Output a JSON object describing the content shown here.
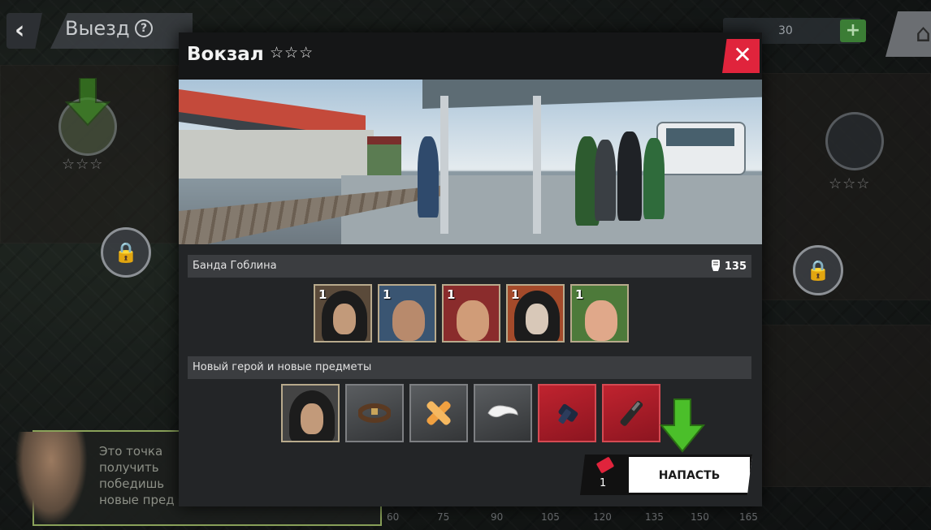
{
  "topbar": {
    "back_icon": "back-arrow-icon",
    "title": "Выезд",
    "help_icon": "help-icon",
    "resource_count": "30",
    "add_icon": "plus-icon",
    "home_icon": "home-icon"
  },
  "map": {
    "tutorial_text": "Это точка\nполучить\nпобедишь\nновые пред",
    "scale_values": [
      "60",
      "75",
      "90",
      "105",
      "120",
      "135",
      "150",
      "165"
    ],
    "node_stars": "☆☆☆"
  },
  "modal": {
    "title": "Вокзал",
    "stars": "☆☆☆",
    "close_icon": "close-icon",
    "scene": "railway-station-scene",
    "gang": {
      "label": "Банда Гоблина",
      "power": "135",
      "power_icon": "fist-icon",
      "members": [
        {
          "level": "1",
          "portrait": "hooded-thug-portrait"
        },
        {
          "level": "1",
          "portrait": "bearded-man-portrait"
        },
        {
          "level": "1",
          "portrait": "cap-man-portrait"
        },
        {
          "level": "1",
          "portrait": "hooded-pale-portrait"
        },
        {
          "level": "1",
          "portrait": "shouting-man-portrait"
        }
      ]
    },
    "rewards": {
      "label": "Новый герой и новые предметы",
      "items": [
        {
          "type": "hero",
          "icon": "hooded-hero-portrait"
        },
        {
          "type": "item",
          "icon": "belt-icon"
        },
        {
          "type": "item",
          "icon": "bandage-icon"
        },
        {
          "type": "item",
          "icon": "mouthguard-icon"
        },
        {
          "type": "item",
          "icon": "hand-wrap-icon"
        },
        {
          "type": "item",
          "icon": "knife-icon"
        }
      ]
    },
    "attack": {
      "ticket_icon": "ticket-icon",
      "ticket_count": "1",
      "button_label": "НАПАСТЬ"
    }
  },
  "colors": {
    "accent_red": "#e0243c",
    "accent_green": "#4bbf2a",
    "panel_bg": "#232527"
  }
}
